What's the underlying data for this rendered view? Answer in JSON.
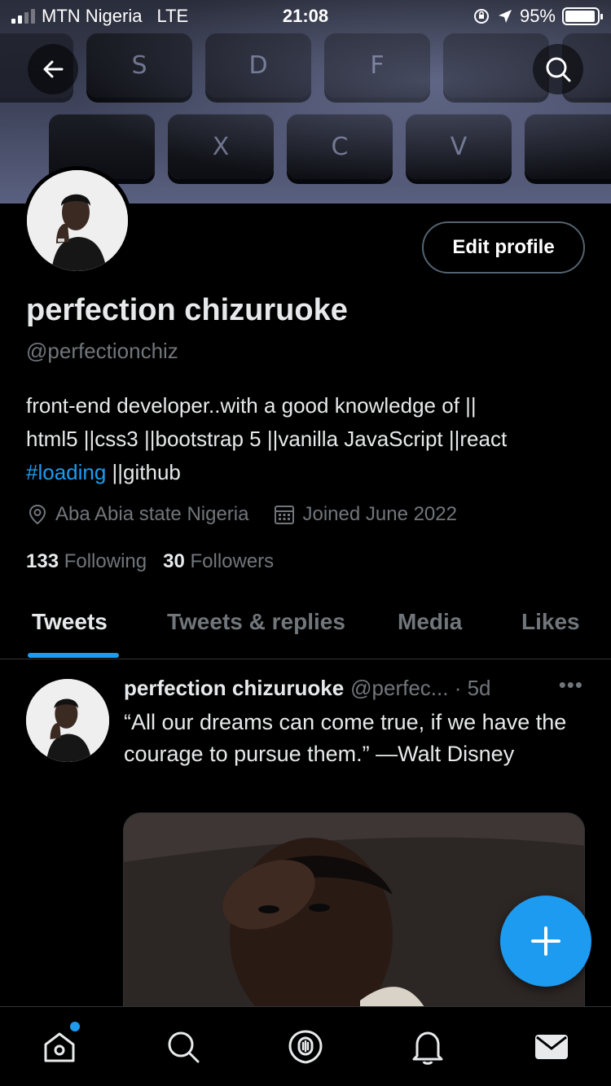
{
  "status_bar": {
    "carrier": "MTN Nigeria",
    "network": "LTE",
    "time": "21:08",
    "battery": "95%",
    "battery_level": 0.95
  },
  "banner": {
    "keys_row1": [
      "S",
      "D",
      "F"
    ],
    "keys_row2": [
      "X",
      "C",
      "V"
    ]
  },
  "header": {
    "back_icon": "arrow-left-icon",
    "search_icon": "search-icon"
  },
  "profile": {
    "edit_label": "Edit profile",
    "name": "perfection chizuruoke",
    "handle": "@perfectionchiz",
    "bio_line1": "front-end developer..with a good knowledge of ||",
    "bio_line2": "html5 ||css3 ||bootstrap 5 ||vanilla JavaScript ||react",
    "bio_tag": "#loading",
    "bio_line3_rest": " ||github",
    "location": "Aba Abia state Nigeria",
    "joined": "Joined June 2022",
    "following_count": "133",
    "following_label": "Following",
    "followers_count": "30",
    "followers_label": "Followers"
  },
  "tabs": [
    "Tweets",
    "Tweets & replies",
    "Media",
    "Likes"
  ],
  "tweet": {
    "name": "perfection chizuruoke",
    "handle_time": "@perfec... · 5d",
    "more": "•••",
    "text": "“All our dreams can come true, if we have the courage to pursue them.” —Walt Disney"
  },
  "colors": {
    "accent": "#1d9bf0",
    "background": "#000000",
    "secondary_text": "#71767b"
  },
  "bottom_nav": [
    "home-icon",
    "search-icon",
    "spaces-icon",
    "notifications-icon",
    "messages-icon"
  ]
}
